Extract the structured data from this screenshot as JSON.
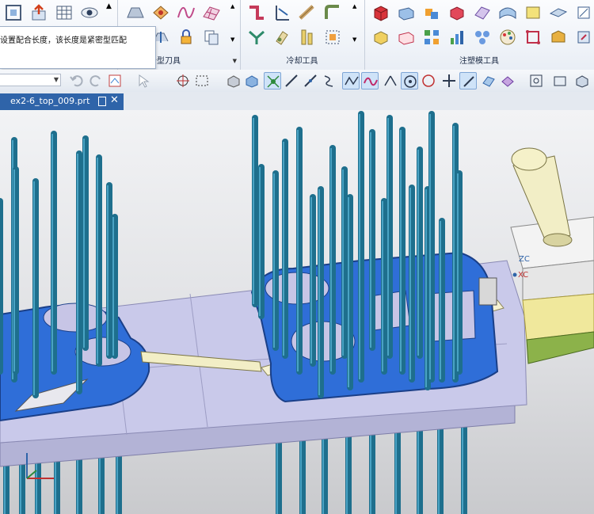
{
  "ribbon": {
    "groups": [
      {
        "label": "分型刀具"
      },
      {
        "label": "冷却工具"
      },
      {
        "label": "注塑模工具"
      }
    ]
  },
  "tooltip": {
    "text": "设置配合长度，该长度是紧密型匹配"
  },
  "file_tab": {
    "label": "ex2-6_top_009.prt"
  },
  "viewport": {
    "wcs_labels": {
      "zc": "ZC",
      "xc": "XC"
    }
  },
  "icons": [
    "ribbon-tool-icons",
    "close-icon",
    "pin-icon",
    "dropdown-arrow-icon",
    "snap-point-icon",
    "coordinate-axis-icon"
  ],
  "colors": {
    "pin": "#1e6f8d",
    "cavity": "#2f6ed8",
    "plate": "#c9c9ea",
    "tab": "#2f64a9",
    "block_yellow": "#f0e89c"
  }
}
